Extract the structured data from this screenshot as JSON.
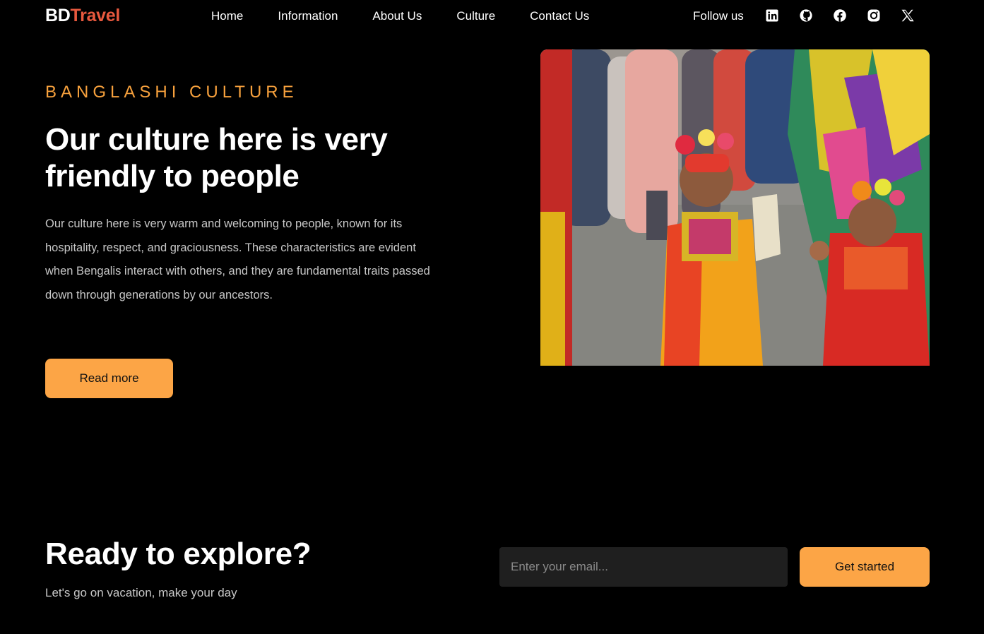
{
  "header": {
    "logo_part1": "BD",
    "logo_part2": "Travel",
    "nav": [
      {
        "label": "Home"
      },
      {
        "label": "Information"
      },
      {
        "label": "About Us"
      },
      {
        "label": "Culture"
      },
      {
        "label": "Contact Us"
      }
    ],
    "follow_label": "Follow us",
    "social_icons": [
      "linkedin-icon",
      "github-icon",
      "facebook-icon",
      "instagram-icon",
      "x-icon"
    ]
  },
  "hero": {
    "eyebrow": "BANGLASHI CULTURE",
    "title": "Our culture here is very friendly to people",
    "text": "Our culture here is very warm and welcoming to people, known for its hospitality, respect, and graciousness. These characteristics are evident when Bengalis interact with others, and they are fundamental traits passed down through generations by our ancestors.",
    "button_label": "Read more"
  },
  "cta": {
    "title": "Ready to explore?",
    "subtitle": "Let's go on vacation, make your day",
    "email_placeholder": "Enter your email...",
    "button_label": "Get started"
  },
  "colors": {
    "background": "#000000",
    "accent": "#fca546",
    "eyebrow": "#f7a13d",
    "logo_accent": "#e8593e",
    "input_bg": "#1f1f1f"
  }
}
